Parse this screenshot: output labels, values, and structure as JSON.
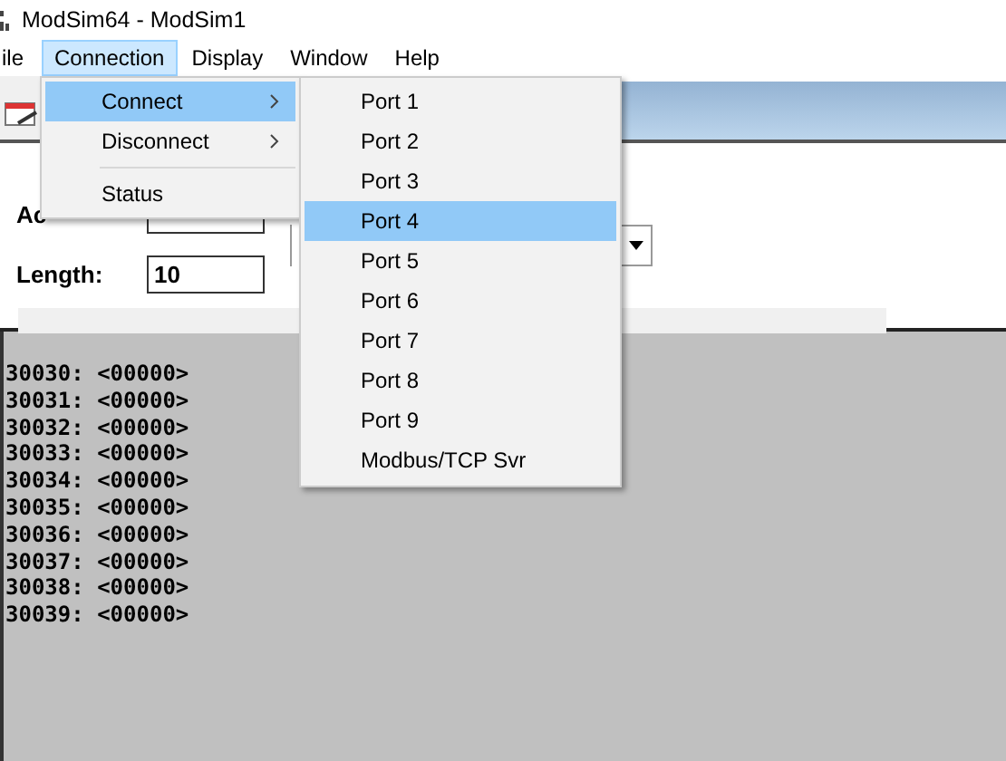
{
  "window": {
    "title": "ModSim64 - ModSim1"
  },
  "menubar": [
    {
      "label": "ile",
      "selected": false
    },
    {
      "label": "Connection",
      "selected": true
    },
    {
      "label": "Display",
      "selected": false
    },
    {
      "label": "Window",
      "selected": false
    },
    {
      "label": "Help",
      "selected": false
    }
  ],
  "connection_menu": [
    {
      "kind": "submenu",
      "label": "Connect",
      "selected": true
    },
    {
      "kind": "submenu",
      "label": "Disconnect",
      "selected": false
    },
    {
      "kind": "separator"
    },
    {
      "kind": "item",
      "label": "Status",
      "selected": false
    }
  ],
  "connect_submenu": [
    {
      "label": "Port 1",
      "selected": false
    },
    {
      "label": "Port 2",
      "selected": false
    },
    {
      "label": "Port 3",
      "selected": false
    },
    {
      "label": "Port 4",
      "selected": true
    },
    {
      "label": "Port 5",
      "selected": false
    },
    {
      "label": "Port 6",
      "selected": false
    },
    {
      "label": "Port 7",
      "selected": false
    },
    {
      "label": "Port 8",
      "selected": false
    },
    {
      "label": "Port 9",
      "selected": false
    },
    {
      "label": "Modbus/TCP Svr",
      "selected": false
    }
  ],
  "form": {
    "address_label": "Ac",
    "length_label": "Length:",
    "length_value": "10"
  },
  "registers": [
    "30030: <00000>",
    "30031: <00000>",
    "30032: <00000>",
    "30033: <00000>",
    "30034: <00000>",
    "30035: <00000>",
    "30036: <00000>",
    "30037: <00000>",
    "30038: <00000>",
    "30039: <00000>"
  ]
}
